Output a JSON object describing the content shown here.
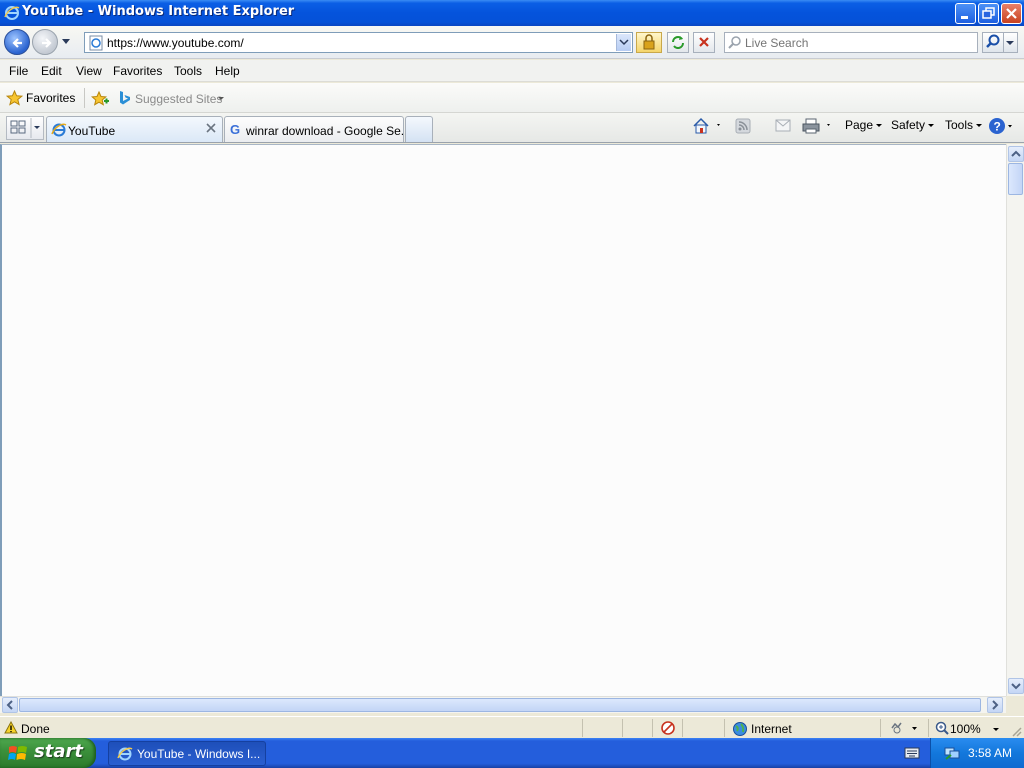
{
  "window": {
    "title": "YouTube - Windows Internet Explorer"
  },
  "address": {
    "url": "https://www.youtube.com/"
  },
  "search": {
    "placeholder": "Live Search"
  },
  "menu": [
    "File",
    "Edit",
    "View",
    "Favorites",
    "Tools",
    "Help"
  ],
  "favorites_bar": {
    "favorites_label": "Favorites",
    "suggested_label": "Suggested Sites"
  },
  "tabs": [
    {
      "label": "YouTube",
      "active": true
    },
    {
      "label": "winrar download - Google Se...",
      "active": false
    }
  ],
  "command_bar": {
    "page": "Page",
    "safety": "Safety",
    "tools": "Tools"
  },
  "status": {
    "text": "Done",
    "zone": "Internet",
    "zoom": "100%"
  },
  "taskbar": {
    "start_label": "start",
    "task_label": "YouTube - Windows I...",
    "clock": "3:58 AM"
  },
  "colors": {
    "titlebar": "#0553dc",
    "taskbar": "#245edc",
    "start_button": "#3c913c"
  }
}
